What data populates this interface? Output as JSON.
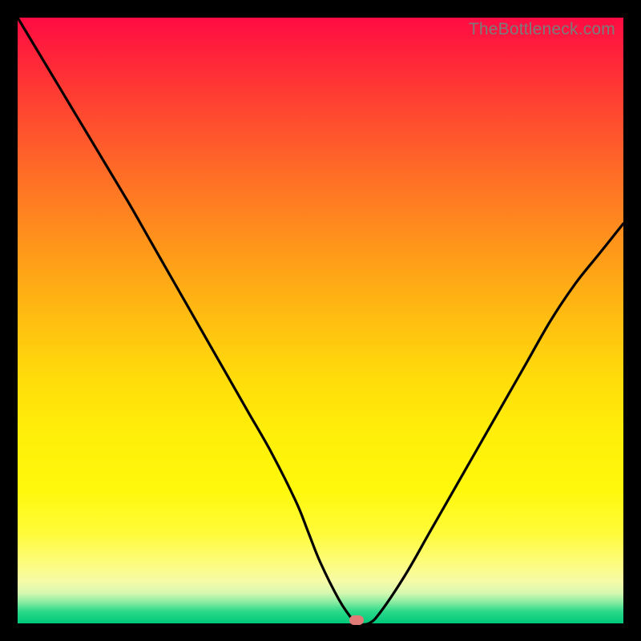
{
  "watermark": "TheBottleneck.com",
  "chart_data": {
    "type": "line",
    "title": "",
    "xlabel": "",
    "ylabel": "",
    "xlim": [
      0,
      100
    ],
    "ylim": [
      0,
      100
    ],
    "grid": false,
    "series": [
      {
        "name": "bottleneck_curve",
        "x": [
          0,
          6,
          12,
          18,
          22,
          26,
          30,
          34,
          38,
          42,
          46,
          48,
          50,
          53,
          55,
          56,
          58,
          60,
          64,
          68,
          72,
          76,
          80,
          84,
          88,
          92,
          96,
          100
        ],
        "values": [
          100,
          90,
          80,
          70,
          63,
          56,
          49,
          42,
          35,
          28,
          20,
          15,
          10,
          4,
          1,
          0,
          0,
          2,
          8,
          15,
          22,
          29,
          36,
          43,
          50,
          56,
          61,
          66
        ]
      }
    ],
    "marker": {
      "x": 56,
      "y": 0.5,
      "color": "#e17b77"
    },
    "gradient_stops": [
      {
        "pos": 0,
        "color": "#ff0b42"
      },
      {
        "pos": 50,
        "color": "#ffd80b"
      },
      {
        "pos": 90,
        "color": "#fdfc7c"
      },
      {
        "pos": 100,
        "color": "#00c97a"
      }
    ]
  }
}
